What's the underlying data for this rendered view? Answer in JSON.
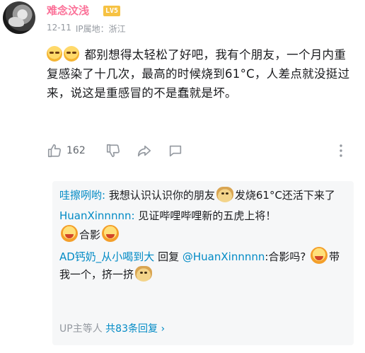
{
  "comment": {
    "user": {
      "name": "难念汶浅",
      "level_badge": "LV5"
    },
    "date": "12-11",
    "ip_location": "IP属地：浙江",
    "text": "都别想得太轻松了好吧，我有个朋友，一个月内重复感染了十几次，最高的时候烧到61°C，人差点就没挺过来，说这是重感冒的不是蠢就是坏。",
    "like_count": "162"
  },
  "replies": [
    {
      "name": "哇擦咧哟:",
      "text_before": "我想认识认识你的朋友",
      "text_after": "发烧61°C还活下来了"
    },
    {
      "name": "HuanXinnnnn:",
      "text": "见证哔哩哔哩新的五虎上将！",
      "text2": "合影"
    },
    {
      "name": "AD钙奶_从小喝到大",
      "reply_word": "回复",
      "mention": "@HuanXinnnnn",
      "text": ":合影吗?",
      "text2": "带我一个，挤一挤"
    }
  ],
  "more_replies": {
    "prefix": "UP主等人",
    "count": "共83条回复",
    "arrow": "›"
  },
  "colors": {
    "username": "#fb7299",
    "link": "#008ac5",
    "meta": "#9499a0",
    "level_badge": "#f6c243",
    "reply_bg": "#f6f7f8"
  },
  "icons": [
    "emoji-face-icon",
    "thumbs-up-icon",
    "thumbs-down-icon",
    "share-icon",
    "comment-icon",
    "more-vertical-icon",
    "doge-sticker-icon",
    "sticker-icon"
  ]
}
